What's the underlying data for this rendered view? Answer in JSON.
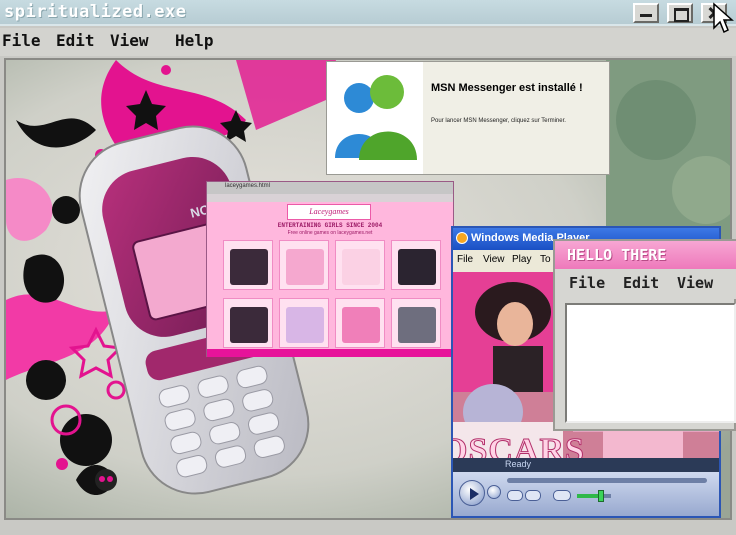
{
  "window": {
    "title": "spiritualized.exe",
    "menu": [
      "File",
      "Edit",
      "View",
      "Help"
    ]
  },
  "msn_dialog": {
    "heading": "MSN Messenger est installé !",
    "body": "Pour lancer MSN Messenger, cliquez sur Terminer."
  },
  "browser": {
    "tab_title": "laceygames.html",
    "logo": "Laceygames",
    "heading": "ENTERTAINING GIRLS SINCE 2004",
    "subheading": "Free online games on laceygames.net"
  },
  "media_player": {
    "title": "Windows Media Player",
    "menu": [
      "File",
      "View",
      "Play",
      "To"
    ],
    "status": "Ready",
    "video_caption": "OSCARS",
    "volume": 0.7
  },
  "hello_window": {
    "title": "HELLO THERE",
    "menu": [
      "File",
      "Edit",
      "View"
    ]
  },
  "colors": {
    "accent_pink": "#ee79bb",
    "wmp_blue": "#1a4fc4",
    "chrome_gray": "#d3d3cf"
  }
}
